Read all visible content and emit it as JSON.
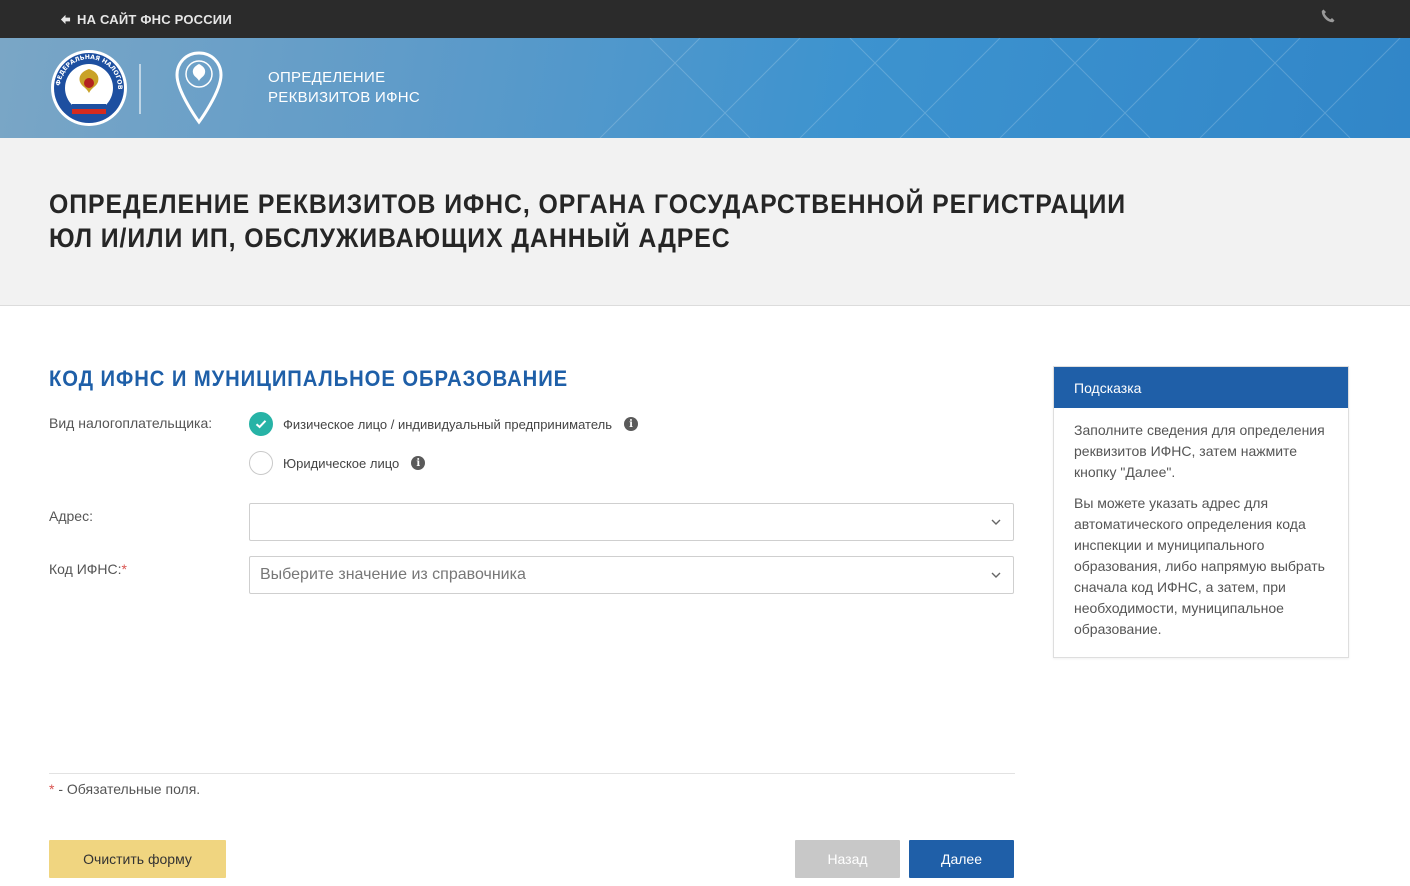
{
  "topbar": {
    "back_label": "НА САЙТ ФНС РОССИИ",
    "icons": [
      "arrow-left-icon",
      "phone-icon"
    ]
  },
  "header": {
    "title_line1": "ОПРЕДЕЛЕНИЕ",
    "title_line2": "РЕКВИЗИТОВ ИФНС",
    "emblem_text": "ФЕДЕРАЛЬНАЯ НАЛОГОВАЯ СЛУЖБА"
  },
  "page": {
    "title": "ОПРЕДЕЛЕНИЕ РЕКВИЗИТОВ ИФНС, ОРГАНА ГОСУДАРСТВЕННОЙ РЕГИСТРАЦИИ ЮЛ И/ИЛИ ИП, ОБСЛУЖИВАЮЩИХ ДАННЫЙ АДРЕС"
  },
  "form": {
    "section_title": "КОД ИФНС И МУНИЦИПАЛЬНОЕ ОБРАЗОВАНИЕ",
    "taxpayer_label": "Вид налогоплательщика:",
    "taxpayer_options": [
      {
        "label": "Физическое лицо / индивидуальный предприниматель",
        "selected": true
      },
      {
        "label": "Юридическое лицо",
        "selected": false
      }
    ],
    "address_label": "Адрес:",
    "address_value": "",
    "ifns_label": "Код ИФНС:",
    "ifns_required_mark": "*",
    "ifns_placeholder": "Выберите значение из справочника",
    "required_note_mark": "*",
    "required_note": " - Обязательные поля."
  },
  "buttons": {
    "clear": "Очистить форму",
    "back": "Назад",
    "next": "Далее"
  },
  "hint": {
    "title": "Подсказка",
    "paragraph1": "Заполните сведения для определения реквизитов ИФНС, затем нажмите кнопку \"Далее\".",
    "paragraph2": "Вы можете указать адрес для автоматического определения кода инспекции и муниципального образования, либо напрямую выбрать сначала код ИФНС, а затем, при необходимости, муниципальное образование."
  },
  "colors": {
    "accent_blue": "#1f5fa8",
    "radio_checked": "#27b3a6",
    "clear_button": "#f0d580",
    "required": "#d9534f"
  }
}
